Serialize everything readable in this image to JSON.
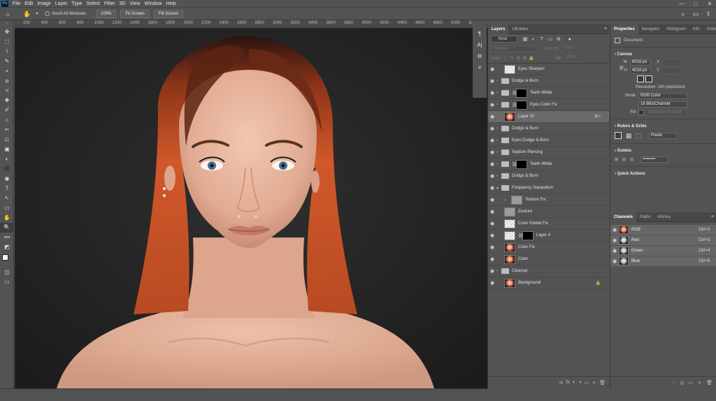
{
  "app": {
    "logo_text": "Ps"
  },
  "menu": [
    "File",
    "Edit",
    "Image",
    "Layer",
    "Type",
    "Select",
    "Filter",
    "3D",
    "View",
    "Window",
    "Help"
  ],
  "window_controls": {
    "minimize": "—",
    "maximize": "□",
    "close": "✕"
  },
  "options_bar": {
    "home_icon": "⌂",
    "hand_icon": "✋",
    "scroll_all_label": "Scroll All Windows",
    "zoom_100_label": "100%",
    "fit_screen_label": "Fit Screen",
    "fill_screen_label": "Fill Screen",
    "search_icon": "⌕",
    "workspace_icon": "▭",
    "share_icon": "⇪"
  },
  "ruler_h": [
    "200",
    "400",
    "600",
    "800",
    "1000",
    "1200",
    "1400",
    "1600",
    "1800",
    "2000",
    "2200",
    "2400",
    "2600",
    "2800",
    "3000",
    "3200",
    "3400",
    "3600",
    "3800",
    "4000",
    "4200",
    "4400",
    "4600",
    "4800",
    "5000",
    "52"
  ],
  "tools": [
    "✥",
    "⬚",
    "⌇",
    "✎",
    "⌖",
    "⧄",
    "⌗",
    "✚",
    "✐",
    "⌂",
    "✂",
    "⎌",
    "▣",
    "◐",
    "⬛",
    "◉",
    "T",
    "↖",
    "▭",
    "✋",
    "🔍",
    "•••",
    "◩",
    "◫",
    "▭"
  ],
  "mini_tools": [
    "¶",
    "A|",
    "⚙",
    "≡"
  ],
  "layers_panel": {
    "tabs": [
      "Layers",
      "Libraries"
    ],
    "kind_label": "Kind",
    "blend_mode": "Normal",
    "opacity_label": "Opacity:",
    "opacity_value": "100%",
    "lock_label": "Lock:",
    "fill_label": "Fill:",
    "fill_value": "100%",
    "layers": [
      {
        "name": "Eyes Sharpen",
        "kind": "layer",
        "thumb": "check",
        "italic": false
      },
      {
        "name": "Dodge & Burn",
        "kind": "group",
        "italic": false
      },
      {
        "name": "Teeth White",
        "kind": "group-mask",
        "italic": false
      },
      {
        "name": "Eyes Color Fix",
        "kind": "group-mask",
        "italic": false
      },
      {
        "name": "Layer 10",
        "kind": "layer",
        "thumb": "face",
        "italic": false,
        "selected": true
      },
      {
        "name": "Dodge & Burn",
        "kind": "group",
        "italic": false
      },
      {
        "name": "Eyes Dodge & Burn",
        "kind": "group",
        "italic": false
      },
      {
        "name": "Septum Piercing",
        "kind": "group",
        "italic": false
      },
      {
        "name": "Teeth White",
        "kind": "group-mask",
        "italic": false
      },
      {
        "name": "Dodge & Burn",
        "kind": "group",
        "italic": false
      },
      {
        "name": "Frequency Separation",
        "kind": "group-open",
        "italic": false
      },
      {
        "name": "Texture Fix",
        "kind": "clipped",
        "thumb": "gray",
        "italic": false
      },
      {
        "name": "Zexture",
        "kind": "layer",
        "thumb": "gray",
        "italic": false
      },
      {
        "name": "Color Global Fix",
        "kind": "layer",
        "thumb": "check",
        "italic": false
      },
      {
        "name": "Layer 4",
        "kind": "layer-mask",
        "thumb": "check",
        "italic": false
      },
      {
        "name": "Color Fix",
        "kind": "layer",
        "thumb": "face",
        "italic": false
      },
      {
        "name": "Color",
        "kind": "layer",
        "thumb": "face",
        "italic": false
      },
      {
        "name": "Cleanup",
        "kind": "group",
        "italic": true
      },
      {
        "name": "Background",
        "kind": "background",
        "thumb": "face",
        "italic": true
      }
    ],
    "footer_icons": [
      "⊖",
      "fx",
      "◐",
      "◑",
      "▭",
      "＋",
      "🗑"
    ]
  },
  "properties_panel": {
    "tabs": [
      "Properties",
      "Navigator",
      "Histogram",
      "Info",
      "Actions"
    ],
    "doc_label": "Document",
    "canvas_title": "Canvas",
    "w_label": "W",
    "w_value": "6016 px",
    "h_label": "H",
    "h_value": "4016 px",
    "x_label": "X",
    "y_label": "Y",
    "resolution": "Resolution: 240 pixels/inch",
    "mode_label": "Mode",
    "mode_value": "RGB Color",
    "depth_value": "16 Bits/Channel",
    "fill_label": "Fill",
    "fill_value": "Background Color",
    "rulers_title": "Rulers & Grids",
    "units_value": "Pixels",
    "guides_title": "Guides",
    "quick_actions_title": "Quick Actions"
  },
  "channels_panel": {
    "tabs": [
      "Channels",
      "Paths",
      "History"
    ],
    "channels": [
      {
        "name": "RGB",
        "shortcut": "Ctrl+2"
      },
      {
        "name": "Red",
        "shortcut": "Ctrl+3"
      },
      {
        "name": "Green",
        "shortcut": "Ctrl+4"
      },
      {
        "name": "Blue",
        "shortcut": "Ctrl+5"
      }
    ],
    "footer_icons": [
      "◌",
      "◎",
      "▭",
      "＋",
      "🗑"
    ]
  },
  "colors": {
    "bg": "#535353",
    "canvas_bg": "#282828",
    "accent": "#31a8ff",
    "hair": "#c5542a",
    "skin": "#e7b39c"
  }
}
